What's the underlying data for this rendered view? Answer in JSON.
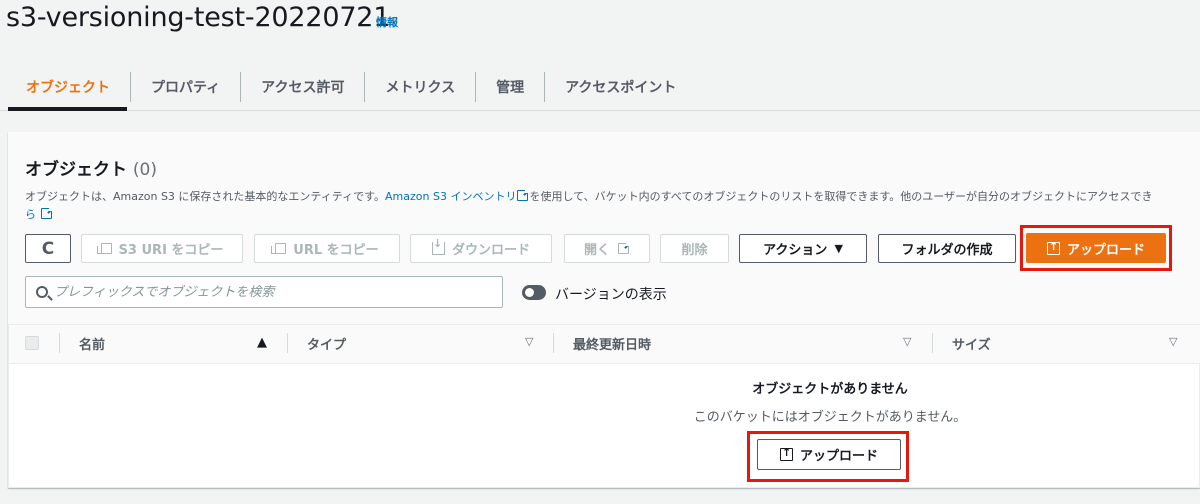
{
  "header": {
    "bucket_name": "s3-versioning-test-20220721",
    "info_link": "情報"
  },
  "tabs": [
    {
      "label": "オブジェクト",
      "active": true
    },
    {
      "label": "プロパティ"
    },
    {
      "label": "アクセス許可"
    },
    {
      "label": "メトリクス"
    },
    {
      "label": "管理"
    },
    {
      "label": "アクセスポイント"
    }
  ],
  "objects_panel": {
    "title": "オブジェクト",
    "count": "(0)",
    "description_prefix": "オブジェクトは、Amazon S3 に保存された基本的なエンティティです。",
    "inventory_link": "Amazon S3 インベントリ",
    "description_suffix": "を使用して、バケット内のすべてのオブジェクトのリストを取得できます。他のユーザーが自分のオブジェクトにアクセスでき",
    "description_wrap": "ら"
  },
  "toolbar": {
    "refresh_icon": "refresh-icon",
    "copy_s3_uri": "S3 URI をコピー",
    "copy_url": "URL をコピー",
    "download": "ダウンロード",
    "open": "開く",
    "delete": "削除",
    "actions": "アクション",
    "create_folder": "フォルダの作成",
    "upload": "アップロード"
  },
  "search": {
    "placeholder": "プレフィックスでオブジェクトを検索",
    "value": ""
  },
  "versions_toggle": {
    "label": "バージョンの表示",
    "enabled": false
  },
  "table": {
    "columns": [
      "名前",
      "タイプ",
      "最終更新日時",
      "サイズ"
    ],
    "rows": []
  },
  "empty_state": {
    "title": "オブジェクトがありません",
    "message": "このバケットにはオブジェクトがありません。",
    "upload_button": "アップロード"
  },
  "colors": {
    "accent": "#ec7211",
    "link": "#0073bb",
    "highlight": "#e6170f"
  }
}
